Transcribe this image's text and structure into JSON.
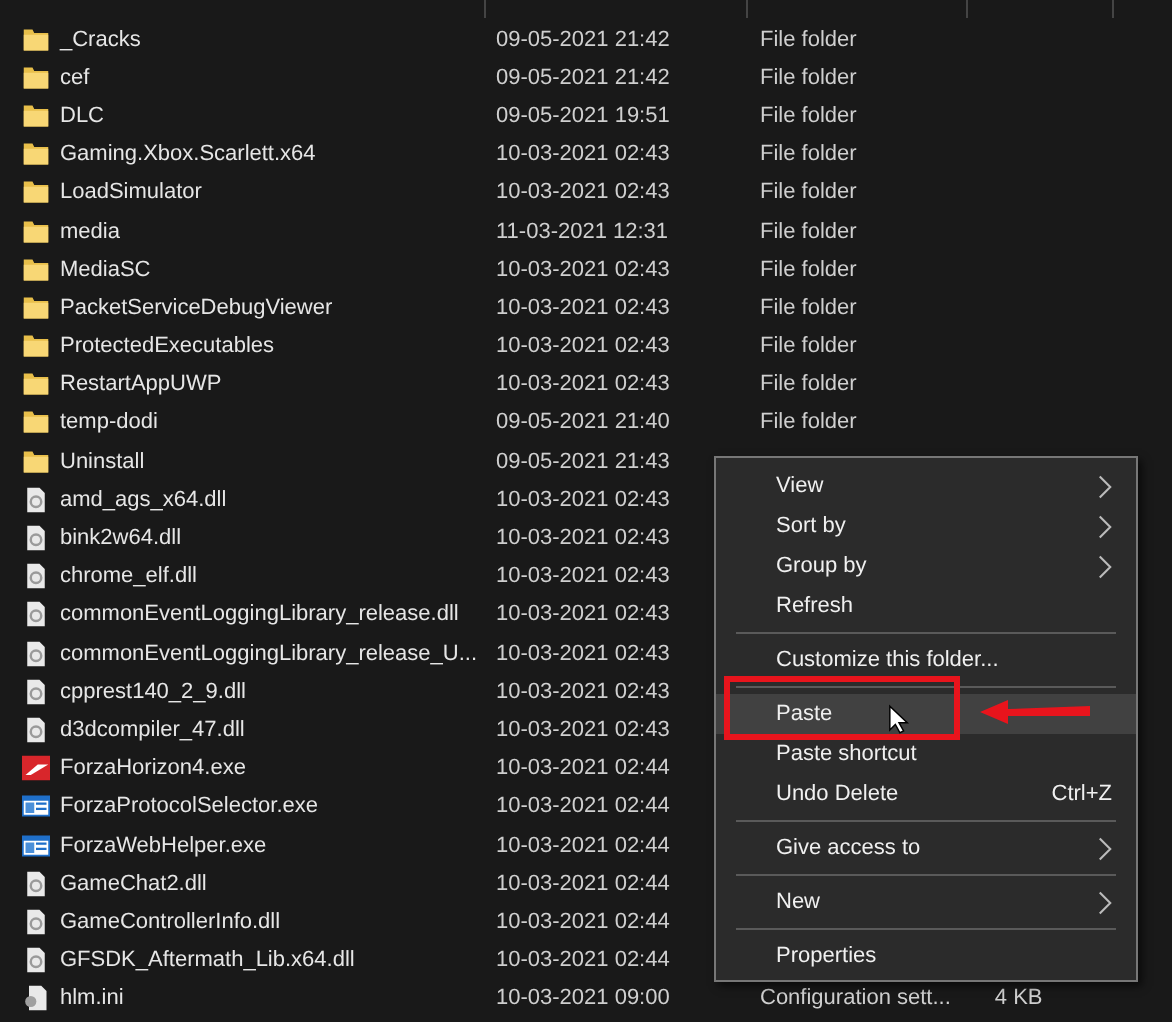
{
  "files": [
    {
      "name": "_Cracks",
      "kind": "folder",
      "modified": "09-05-2021 21:42",
      "type": "File folder"
    },
    {
      "name": "cef",
      "kind": "folder",
      "modified": "09-05-2021 21:42",
      "type": "File folder"
    },
    {
      "name": "DLC",
      "kind": "folder",
      "modified": "09-05-2021 19:51",
      "type": "File folder"
    },
    {
      "name": "Gaming.Xbox.Scarlett.x64",
      "kind": "folder",
      "modified": "10-03-2021 02:43",
      "type": "File folder"
    },
    {
      "name": "LoadSimulator",
      "kind": "folder",
      "modified": "10-03-2021 02:43",
      "type": "File folder"
    },
    {
      "name": "media",
      "kind": "folder",
      "modified": "11-03-2021 12:31",
      "type": "File folder"
    },
    {
      "name": "MediaSC",
      "kind": "folder",
      "modified": "10-03-2021 02:43",
      "type": "File folder"
    },
    {
      "name": "PacketServiceDebugViewer",
      "kind": "folder",
      "modified": "10-03-2021 02:43",
      "type": "File folder"
    },
    {
      "name": "ProtectedExecutables",
      "kind": "folder",
      "modified": "10-03-2021 02:43",
      "type": "File folder"
    },
    {
      "name": "RestartAppUWP",
      "kind": "folder",
      "modified": "10-03-2021 02:43",
      "type": "File folder"
    },
    {
      "name": "temp-dodi",
      "kind": "folder",
      "modified": "09-05-2021 21:40",
      "type": "File folder"
    },
    {
      "name": "Uninstall",
      "kind": "folder",
      "modified": "09-05-2021 21:43"
    },
    {
      "name": "amd_ags_x64.dll",
      "kind": "dll",
      "modified": "10-03-2021 02:43"
    },
    {
      "name": "bink2w64.dll",
      "kind": "dll",
      "modified": "10-03-2021 02:43"
    },
    {
      "name": "chrome_elf.dll",
      "kind": "dll",
      "modified": "10-03-2021 02:43"
    },
    {
      "name": "commonEventLoggingLibrary_release.dll",
      "kind": "dll",
      "modified": "10-03-2021 02:43"
    },
    {
      "name": "commonEventLoggingLibrary_release_U...",
      "kind": "dll",
      "modified": "10-03-2021 02:43"
    },
    {
      "name": "cpprest140_2_9.dll",
      "kind": "dll",
      "modified": "10-03-2021 02:43"
    },
    {
      "name": "d3dcompiler_47.dll",
      "kind": "dll",
      "modified": "10-03-2021 02:43"
    },
    {
      "name": "ForzaHorizon4.exe",
      "kind": "game",
      "modified": "10-03-2021 02:44"
    },
    {
      "name": "ForzaProtocolSelector.exe",
      "kind": "app",
      "modified": "10-03-2021 02:44"
    },
    {
      "name": "ForzaWebHelper.exe",
      "kind": "app",
      "modified": "10-03-2021 02:44"
    },
    {
      "name": "GameChat2.dll",
      "kind": "dll",
      "modified": "10-03-2021 02:44"
    },
    {
      "name": "GameControllerInfo.dll",
      "kind": "dll",
      "modified": "10-03-2021 02:44"
    },
    {
      "name": "GFSDK_Aftermath_Lib.x64.dll",
      "kind": "dll",
      "modified": "10-03-2021 02:44"
    },
    {
      "name": "hlm.ini",
      "kind": "ini",
      "modified": "10-03-2021 09:00",
      "type": "Configuration sett...",
      "size": "4 KB"
    }
  ],
  "context_menu": {
    "groups": [
      [
        {
          "label": "View",
          "submenu": true,
          "selected": false
        },
        {
          "label": "Sort by",
          "submenu": true,
          "selected": false
        },
        {
          "label": "Group by",
          "submenu": true,
          "selected": false
        },
        {
          "label": "Refresh",
          "submenu": false,
          "selected": false
        }
      ],
      [
        {
          "label": "Customize this folder...",
          "submenu": false,
          "selected": false
        }
      ],
      [
        {
          "label": "Paste",
          "submenu": false,
          "selected": true,
          "highlighted": true
        },
        {
          "label": "Paste shortcut",
          "submenu": false,
          "selected": false
        },
        {
          "label": "Undo Delete",
          "shortcut": "Ctrl+Z",
          "submenu": false,
          "selected": false
        }
      ],
      [
        {
          "label": "Give access to",
          "submenu": true,
          "selected": false
        }
      ],
      [
        {
          "label": "New",
          "submenu": true,
          "selected": false
        }
      ],
      [
        {
          "label": "Properties",
          "submenu": false,
          "selected": false
        }
      ]
    ]
  }
}
